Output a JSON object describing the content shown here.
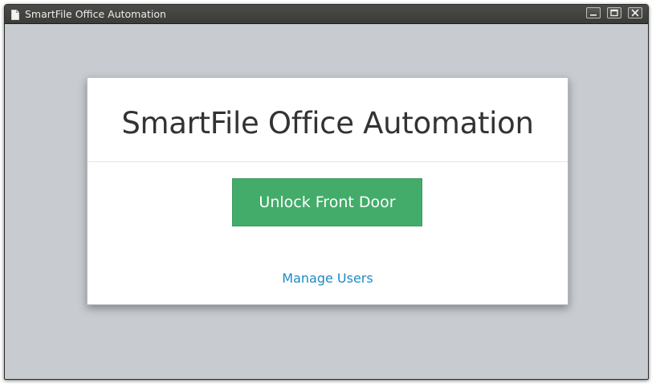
{
  "window": {
    "title": "SmartFile Office Automation",
    "controls": {
      "minimize_icon": "minimize-icon",
      "maximize_icon": "maximize-icon",
      "close_icon": "close-icon"
    }
  },
  "card": {
    "heading": "SmartFile Office Automation",
    "primary_button_label": "Unlock Front Door",
    "secondary_link_label": "Manage Users"
  },
  "colors": {
    "background": "#c8cbd0",
    "primary_button": "#43ac6a",
    "link": "#1d8ac4",
    "titlebar": "#3f3f3c"
  }
}
